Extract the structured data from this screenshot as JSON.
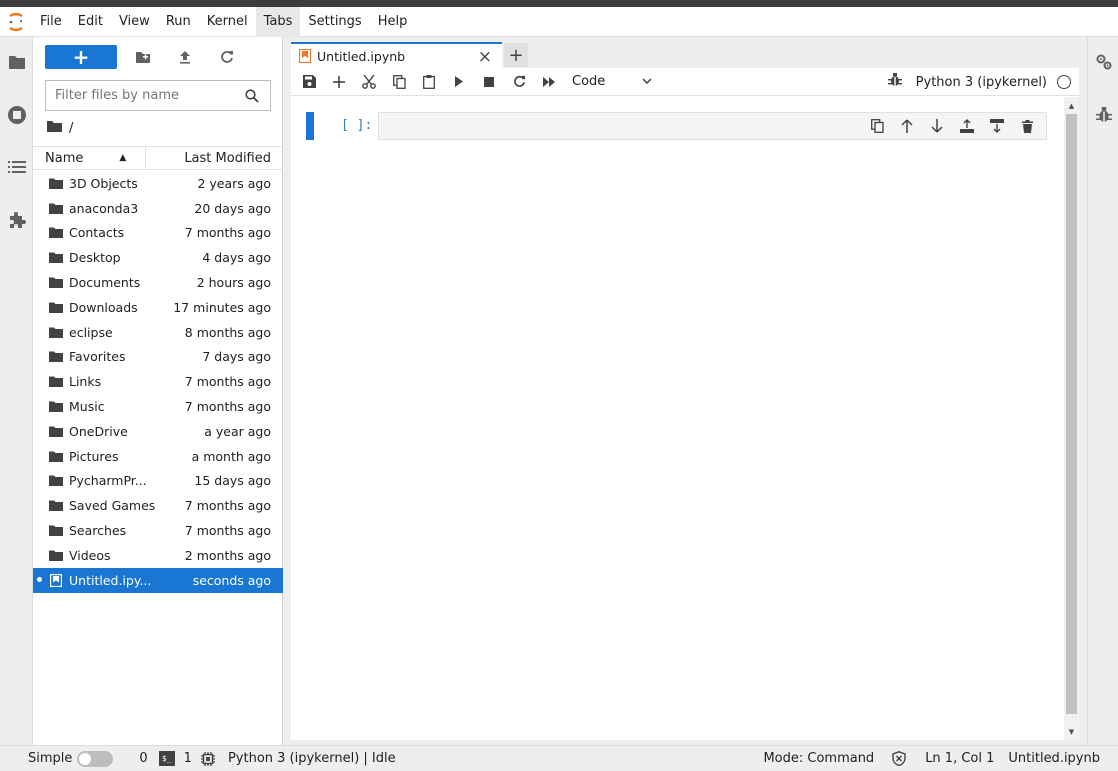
{
  "menubar": {
    "items": [
      "File",
      "Edit",
      "View",
      "Run",
      "Kernel",
      "Tabs",
      "Settings",
      "Help"
    ],
    "active": "Tabs"
  },
  "filebrowser": {
    "new_label": "+",
    "filter_placeholder": "Filter files by name",
    "breadcrumb": "/",
    "col_name": "Name",
    "col_modified": "Last Modified",
    "items": [
      {
        "name": "3D Objects",
        "modified": "2 years ago",
        "type": "folder"
      },
      {
        "name": "anaconda3",
        "modified": "20 days ago",
        "type": "folder"
      },
      {
        "name": "Contacts",
        "modified": "7 months ago",
        "type": "folder"
      },
      {
        "name": "Desktop",
        "modified": "4 days ago",
        "type": "folder"
      },
      {
        "name": "Documents",
        "modified": "2 hours ago",
        "type": "folder"
      },
      {
        "name": "Downloads",
        "modified": "17 minutes ago",
        "type": "folder"
      },
      {
        "name": "eclipse",
        "modified": "8 months ago",
        "type": "folder"
      },
      {
        "name": "Favorites",
        "modified": "7 days ago",
        "type": "folder"
      },
      {
        "name": "Links",
        "modified": "7 months ago",
        "type": "folder"
      },
      {
        "name": "Music",
        "modified": "7 months ago",
        "type": "folder"
      },
      {
        "name": "OneDrive",
        "modified": "a year ago",
        "type": "folder"
      },
      {
        "name": "Pictures",
        "modified": "a month ago",
        "type": "folder"
      },
      {
        "name": "PycharmPr...",
        "modified": "15 days ago",
        "type": "folder"
      },
      {
        "name": "Saved Games",
        "modified": "7 months ago",
        "type": "folder"
      },
      {
        "name": "Searches",
        "modified": "7 months ago",
        "type": "folder"
      },
      {
        "name": "Videos",
        "modified": "2 months ago",
        "type": "folder"
      },
      {
        "name": "Untitled.ipy...",
        "modified": "seconds ago",
        "type": "notebook",
        "selected": true
      }
    ]
  },
  "notebook": {
    "tab_label": "Untitled.ipynb",
    "tab_close": "×",
    "add_tab": "+",
    "cell_type": "Code",
    "kernel": "Python 3 (ipykernel)",
    "prompt": "[ ]:"
  },
  "statusbar": {
    "simple_label": "Simple",
    "terminals_count": "0",
    "terminal_glyph": "$_",
    "kernels_count": "1",
    "kernel_status": "Python 3 (ipykernel) | Idle",
    "mode": "Mode: Command",
    "position": "Ln 1, Col 1",
    "filename": "Untitled.ipynb"
  },
  "colors": {
    "accent": "#1976d2",
    "logo": "#f37626",
    "prompt": "#307fc1"
  }
}
